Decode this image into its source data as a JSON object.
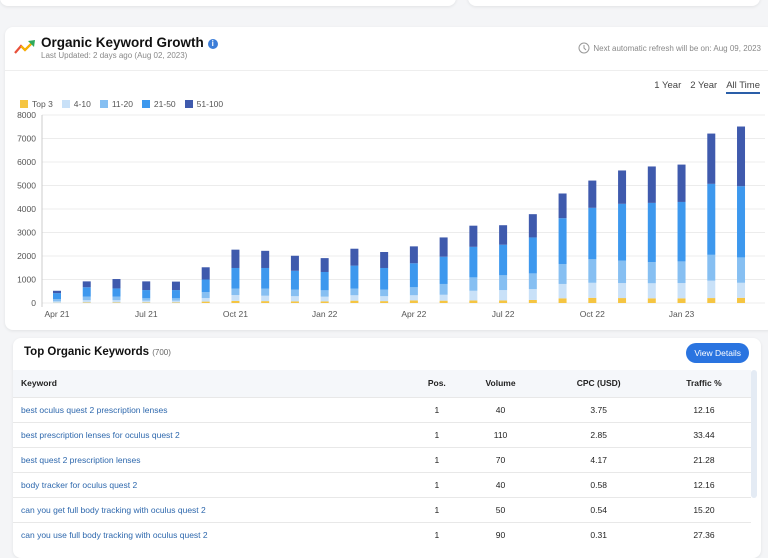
{
  "growth": {
    "title": "Organic Keyword Growth",
    "last_updated": "Last Updated: 2 days ago (Aug 02, 2023)",
    "refresh_note": "Next automatic refresh will be on: Aug 09, 2023",
    "tabs": [
      "1 Year",
      "2 Year",
      "All Time"
    ],
    "active_tab": "All Time"
  },
  "chart_data": {
    "type": "bar",
    "stacked": true,
    "title": "",
    "xlabel": "",
    "ylabel": "",
    "ylim": [
      0,
      8000
    ],
    "yticks": [
      0,
      1000,
      2000,
      3000,
      4000,
      5000,
      6000,
      7000,
      8000
    ],
    "grid": true,
    "legend_position": "top-left",
    "categories": [
      "Apr 21",
      "May 21",
      "Jun 21",
      "Jul 21",
      "Aug 21",
      "Sep 21",
      "Oct 21",
      "Nov 21",
      "Dec 21",
      "Jan 22",
      "Feb 22",
      "Mar 22",
      "Apr 22",
      "May 22",
      "Jun 22",
      "Jul 22",
      "Aug 22",
      "Sep 22",
      "Oct 22",
      "Nov 22",
      "Dec 22",
      "Jan 23",
      "Feb 23",
      "Mar 23"
    ],
    "xtick_labels": [
      "Apr 21",
      "Jul 21",
      "Oct 21",
      "Jan 22",
      "Apr 22",
      "Jul 22",
      "Oct 22",
      "Jan 23"
    ],
    "series": [
      {
        "name": "Top 3",
        "color": "#f5c542",
        "values": [
          10,
          20,
          20,
          20,
          20,
          60,
          90,
          80,
          70,
          70,
          100,
          80,
          110,
          100,
          110,
          110,
          130,
          200,
          220,
          210,
          200,
          200,
          210,
          220
        ]
      },
      {
        "name": "4-10",
        "color": "#c9e1f8",
        "values": [
          60,
          100,
          100,
          80,
          80,
          150,
          250,
          230,
          220,
          200,
          230,
          210,
          220,
          250,
          410,
          440,
          460,
          610,
          640,
          640,
          640,
          650,
          740,
          640
        ]
      },
      {
        "name": "11-20",
        "color": "#86bff2",
        "values": [
          100,
          150,
          150,
          100,
          100,
          250,
          270,
          300,
          280,
          270,
          280,
          280,
          340,
          460,
          570,
          630,
          670,
          850,
          1000,
          950,
          900,
          920,
          1100,
          1080
        ]
      },
      {
        "name": "21-50",
        "color": "#3d98ee",
        "values": [
          250,
          400,
          350,
          350,
          350,
          540,
          880,
          880,
          800,
          780,
          980,
          920,
          1020,
          1160,
          1300,
          1300,
          1530,
          1950,
          2190,
          2420,
          2520,
          2530,
          3020,
          3030
        ]
      },
      {
        "name": "51-100",
        "color": "#3f5aad",
        "values": [
          100,
          250,
          400,
          370,
          360,
          520,
          780,
          730,
          640,
          590,
          720,
          680,
          720,
          820,
          900,
          830,
          990,
          1050,
          1160,
          1420,
          1550,
          1590,
          2140,
          2540
        ]
      }
    ]
  },
  "keywords": {
    "title": "Top Organic Keywords",
    "count": "(700)",
    "view_details": "View Details",
    "columns": [
      "Keyword",
      "Pos.",
      "Volume",
      "CPC (USD)",
      "Traffic %"
    ],
    "rows": [
      [
        "best oculus quest 2 prescription lenses",
        "1",
        "40",
        "3.75",
        "12.16"
      ],
      [
        "best prescription lenses for oculus quest 2",
        "1",
        "110",
        "2.85",
        "33.44"
      ],
      [
        "best quest 2 prescription lenses",
        "1",
        "70",
        "4.17",
        "21.28"
      ],
      [
        "body tracker for oculus quest 2",
        "1",
        "40",
        "0.58",
        "12.16"
      ],
      [
        "can you get full body tracking with oculus quest 2",
        "1",
        "50",
        "0.54",
        "15.20"
      ],
      [
        "can you use full body tracking with oculus quest 2",
        "1",
        "90",
        "0.31",
        "27.36"
      ]
    ]
  }
}
